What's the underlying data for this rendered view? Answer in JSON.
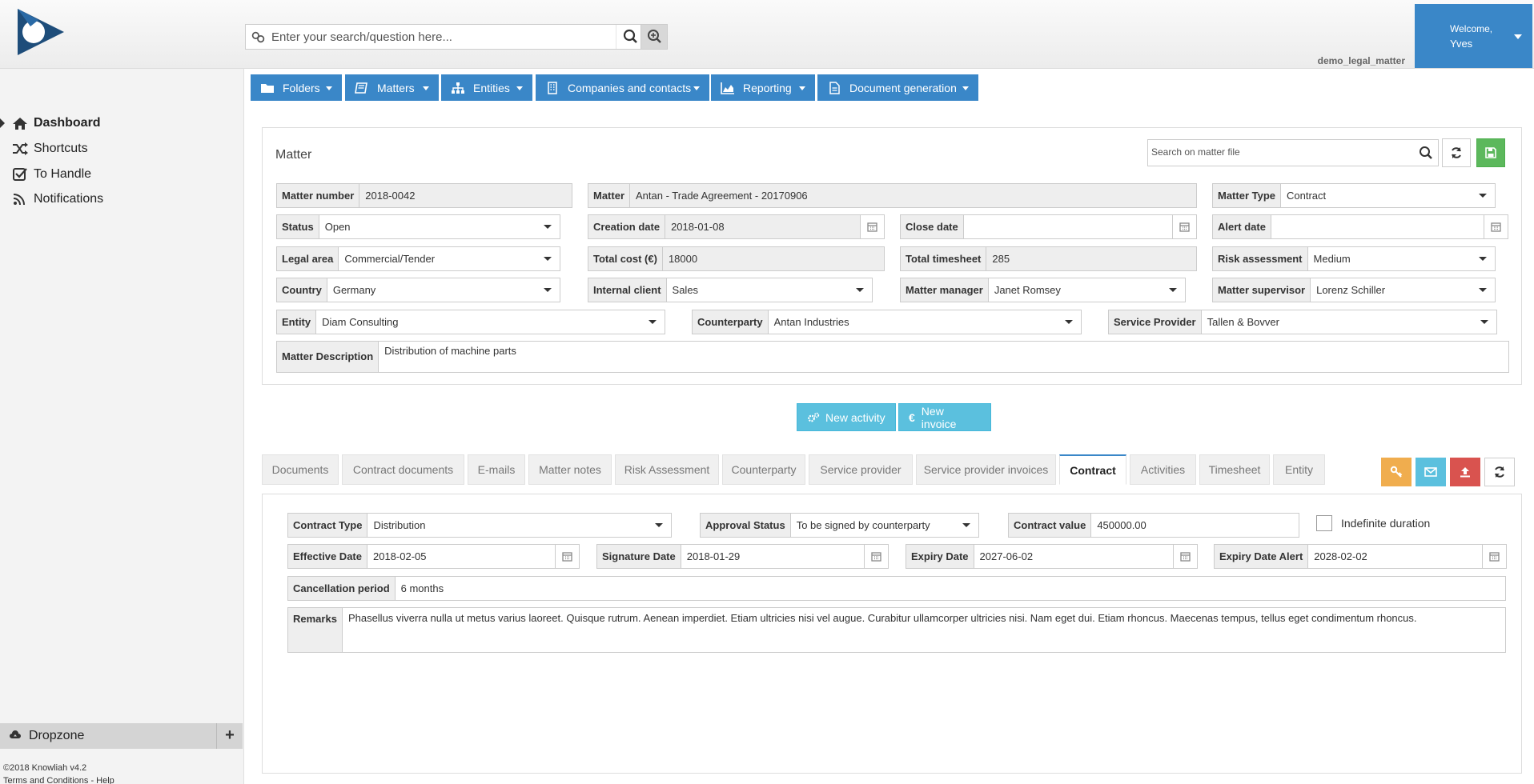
{
  "header": {
    "search_placeholder": "Enter your search/question here...",
    "welcome_line1": "Welcome,",
    "welcome_line2": "Yves",
    "tenant": "demo_legal_matter"
  },
  "sidebar": {
    "items": [
      {
        "label": "Dashboard",
        "icon": "home-icon"
      },
      {
        "label": "Shortcuts",
        "icon": "shuffle-icon"
      },
      {
        "label": "To Handle",
        "icon": "check-square-icon"
      },
      {
        "label": "Notifications",
        "icon": "rss-icon"
      }
    ],
    "dropzone_label": "Dropzone",
    "dropzone_add": "+",
    "footer_line1": "©2018 Knowliah v4.2",
    "footer_line2": "Terms and Conditions - Help"
  },
  "menu": [
    {
      "label": "Folders",
      "icon": "folder-icon"
    },
    {
      "label": "Matters",
      "icon": "book-icon"
    },
    {
      "label": "Entities",
      "icon": "sitemap-icon"
    },
    {
      "label": "Companies and contacts",
      "icon": "building-icon"
    },
    {
      "label": "Reporting",
      "icon": "area-chart-icon"
    },
    {
      "label": "Document generation",
      "icon": "file-icon"
    }
  ],
  "matter": {
    "title": "Matter",
    "search_placeholder": "Search on matter file",
    "fields": {
      "matter_number": {
        "label": "Matter number",
        "value": "2018-0042"
      },
      "matter": {
        "label": "Matter",
        "value": "Antan - Trade Agreement - 20170906"
      },
      "matter_type": {
        "label": "Matter Type",
        "value": "Contract"
      },
      "status": {
        "label": "Status",
        "value": "Open"
      },
      "creation_date": {
        "label": "Creation date",
        "value": "2018-01-08"
      },
      "close_date": {
        "label": "Close date",
        "value": ""
      },
      "alert_date": {
        "label": "Alert date",
        "value": ""
      },
      "legal_area": {
        "label": "Legal area",
        "value": "Commercial/Tender"
      },
      "total_cost": {
        "label": "Total cost (€)",
        "value": "18000"
      },
      "total_timesheet": {
        "label": "Total timesheet",
        "value": "285"
      },
      "risk_assessment": {
        "label": "Risk assessment",
        "value": "Medium"
      },
      "country": {
        "label": "Country",
        "value": "Germany"
      },
      "internal_client": {
        "label": "Internal client",
        "value": "Sales"
      },
      "matter_manager": {
        "label": "Matter manager",
        "value": "Janet Romsey"
      },
      "matter_supervisor": {
        "label": "Matter supervisor",
        "value": "Lorenz Schiller"
      },
      "entity": {
        "label": "Entity",
        "value": "Diam Consulting"
      },
      "counterparty": {
        "label": "Counterparty",
        "value": "Antan Industries"
      },
      "service_provider": {
        "label": "Service Provider",
        "value": "Tallen & Bovver"
      },
      "matter_description": {
        "label": "Matter Description",
        "value": "Distribution of machine parts"
      }
    }
  },
  "actions": {
    "new_activity": "New activity",
    "new_invoice": "New invoice"
  },
  "tabs": [
    {
      "label": "Documents"
    },
    {
      "label": "Contract documents"
    },
    {
      "label": "E-mails"
    },
    {
      "label": "Matter notes"
    },
    {
      "label": "Risk Assessment"
    },
    {
      "label": "Counterparty"
    },
    {
      "label": "Service provider"
    },
    {
      "label": "Service provider invoices"
    },
    {
      "label": "Contract"
    },
    {
      "label": "Activities"
    },
    {
      "label": "Timesheet"
    },
    {
      "label": "Entity"
    }
  ],
  "active_tab": "Contract",
  "contract": {
    "contract_type": {
      "label": "Contract Type",
      "value": "Distribution"
    },
    "approval_status": {
      "label": "Approval Status",
      "value": "To be signed by counterparty"
    },
    "contract_value": {
      "label": "Contract value",
      "value": "450000.00"
    },
    "indefinite_duration": {
      "label": "Indefinite duration",
      "checked": false
    },
    "effective_date": {
      "label": "Effective Date",
      "value": "2018-02-05"
    },
    "signature_date": {
      "label": "Signature Date",
      "value": "2018-01-29"
    },
    "expiry_date": {
      "label": "Expiry Date",
      "value": "2027-06-02"
    },
    "expiry_date_alert": {
      "label": "Expiry Date Alert",
      "value": "2028-02-02"
    },
    "cancellation_period": {
      "label": "Cancellation period",
      "value": "6 months"
    },
    "remarks": {
      "label": "Remarks",
      "value": "Phasellus viverra nulla ut metus varius laoreet. Quisque rutrum. Aenean imperdiet. Etiam ultricies nisi vel augue. Curabitur ullamcorper ultricies nisi. Nam eget dui. Etiam rhoncus. Maecenas tempus, tellus eget condimentum rhoncus."
    }
  },
  "colors": {
    "primary": "#3a87c8",
    "info": "#5bc0de",
    "success": "#5cb85c",
    "warning": "#f0ad4e",
    "danger": "#d9534f"
  }
}
